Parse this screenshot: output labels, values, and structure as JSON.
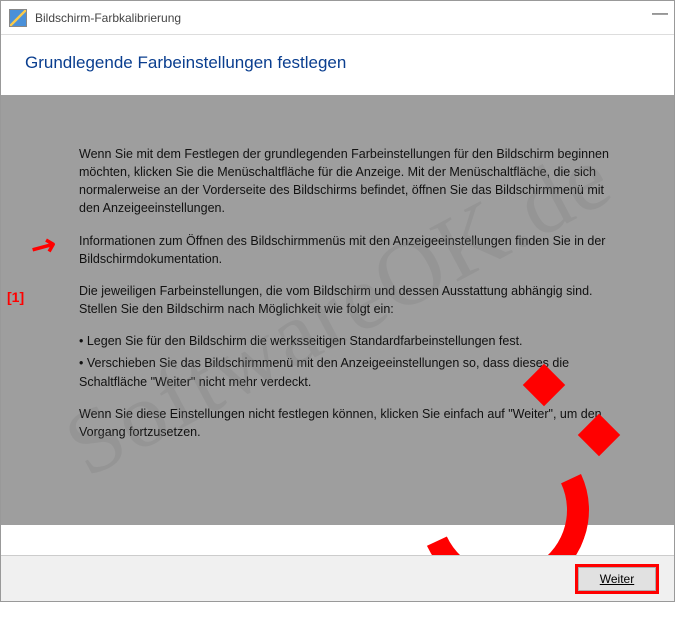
{
  "titlebar": {
    "title": "Bildschirm-Farbkalibrierung"
  },
  "header": {
    "heading": "Grundlegende Farbeinstellungen festlegen"
  },
  "content": {
    "p1": "Wenn Sie mit dem Festlegen der grundlegenden Farbeinstellungen für den Bildschirm beginnen möchten, klicken Sie die Menüschaltfläche für die Anzeige. Mit der Menüschaltfläche, die sich normalerweise an der Vorderseite des Bildschirms befindet, öffnen Sie das Bildschirmmenü mit den Anzeigeeinstellungen.",
    "p2": "Informationen zum Öffnen des Bildschirmmenüs mit den Anzeigeeinstellungen finden Sie in der Bildschirmdokumentation.",
    "p3": "Die jeweiligen Farbeinstellungen, die vom Bildschirm und dessen Ausstattung abhängig sind. Stellen Sie den Bildschirm nach Möglichkeit wie folgt ein:",
    "b1": "• Legen Sie für den Bildschirm die werksseitigen Standardfarbeinstellungen fest.",
    "b2": "• Verschieben Sie das Bildschirmmenü mit den Anzeigeeinstellungen so, dass dieses die Schaltfläche \"Weiter\" nicht mehr verdeckt.",
    "p4": "Wenn Sie diese Einstellungen nicht festlegen können, klicken Sie einfach auf \"Weiter\", um den Vorgang fortzusetzen."
  },
  "footer": {
    "next": "Weiter"
  },
  "annotation": {
    "label": "[1]"
  },
  "watermark": "SoftwareOK.de"
}
